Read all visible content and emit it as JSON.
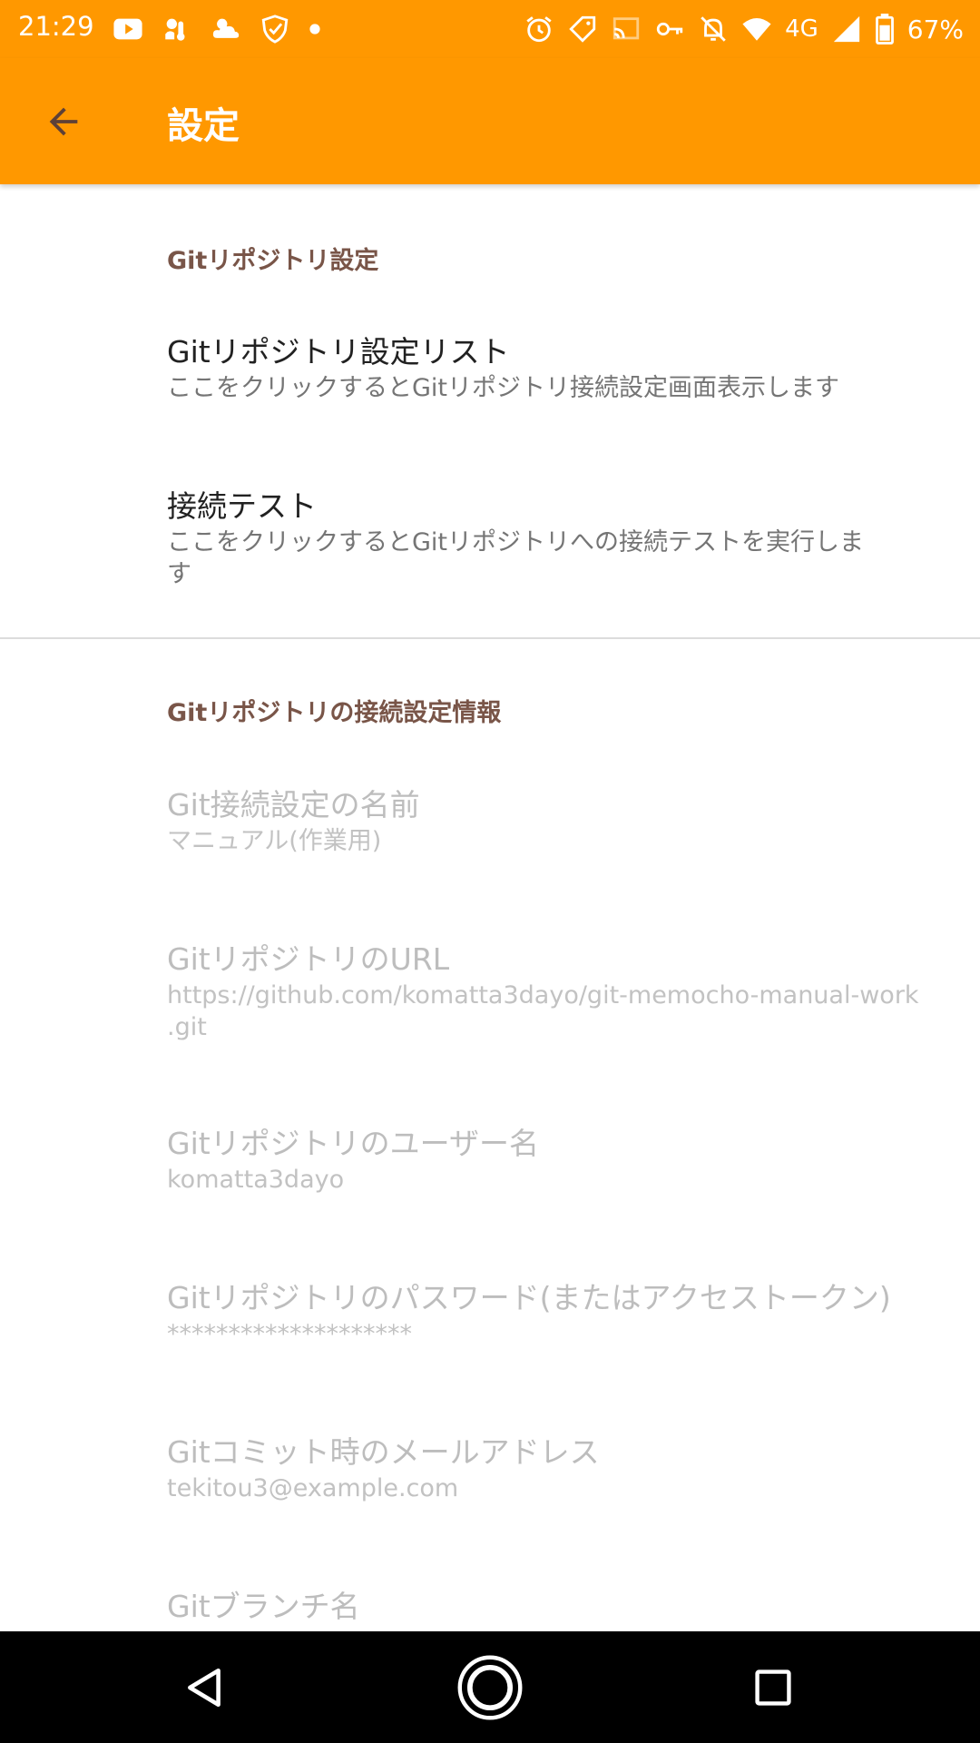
{
  "status_bar": {
    "time": "21:29",
    "network": "4G",
    "battery": "67%",
    "left_icons": [
      "youtube-icon",
      "weather-icon",
      "cloud-icon",
      "shield-check-icon",
      "dot-icon"
    ],
    "right_icons": [
      "alarm-icon",
      "tag-icon",
      "cast-icon",
      "key-icon",
      "notifications-off-icon",
      "wifi-icon",
      "signal-icon",
      "battery-icon"
    ]
  },
  "toolbar": {
    "title": "設定",
    "back_icon": "arrow-back-icon",
    "color": "#ff9800"
  },
  "sections": [
    {
      "header": "Gitリポジトリ設定",
      "items": [
        {
          "title": "Gitリポジトリ設定リスト",
          "summary": "ここをクリックするとGitリポジトリ接続設定画面表示します",
          "enabled": true
        },
        {
          "title": "接続テスト",
          "summary": "ここをクリックするとGitリポジトリへの接続テストを実行しま",
          "summary2": "す",
          "enabled": true
        }
      ]
    },
    {
      "header": "Gitリポジトリの接続設定情報",
      "items": [
        {
          "title": "Git接続設定の名前",
          "summary": "マニュアル(作業用)",
          "enabled": false
        },
        {
          "title": "GitリポジトリのURL",
          "summary": "https://github.com/komatta3dayo/git-memocho-manual-work",
          "summary2": ".git",
          "enabled": false
        },
        {
          "title": "Gitリポジトリのユーザー名",
          "summary": "komatta3dayo",
          "enabled": false
        },
        {
          "title": "Gitリポジトリのパスワード(またはアクセストークン)",
          "summary": "********************",
          "enabled": false
        },
        {
          "title": "Gitコミット時のメールアドレス",
          "summary": "tekitou3@example.com",
          "enabled": false
        },
        {
          "title": "Gitブランチ名",
          "enabled": false
        }
      ]
    }
  ],
  "nav_bar": {
    "back_icon": "nav-back-icon",
    "home_icon": "nav-home-icon",
    "recents_icon": "nav-recents-icon"
  }
}
